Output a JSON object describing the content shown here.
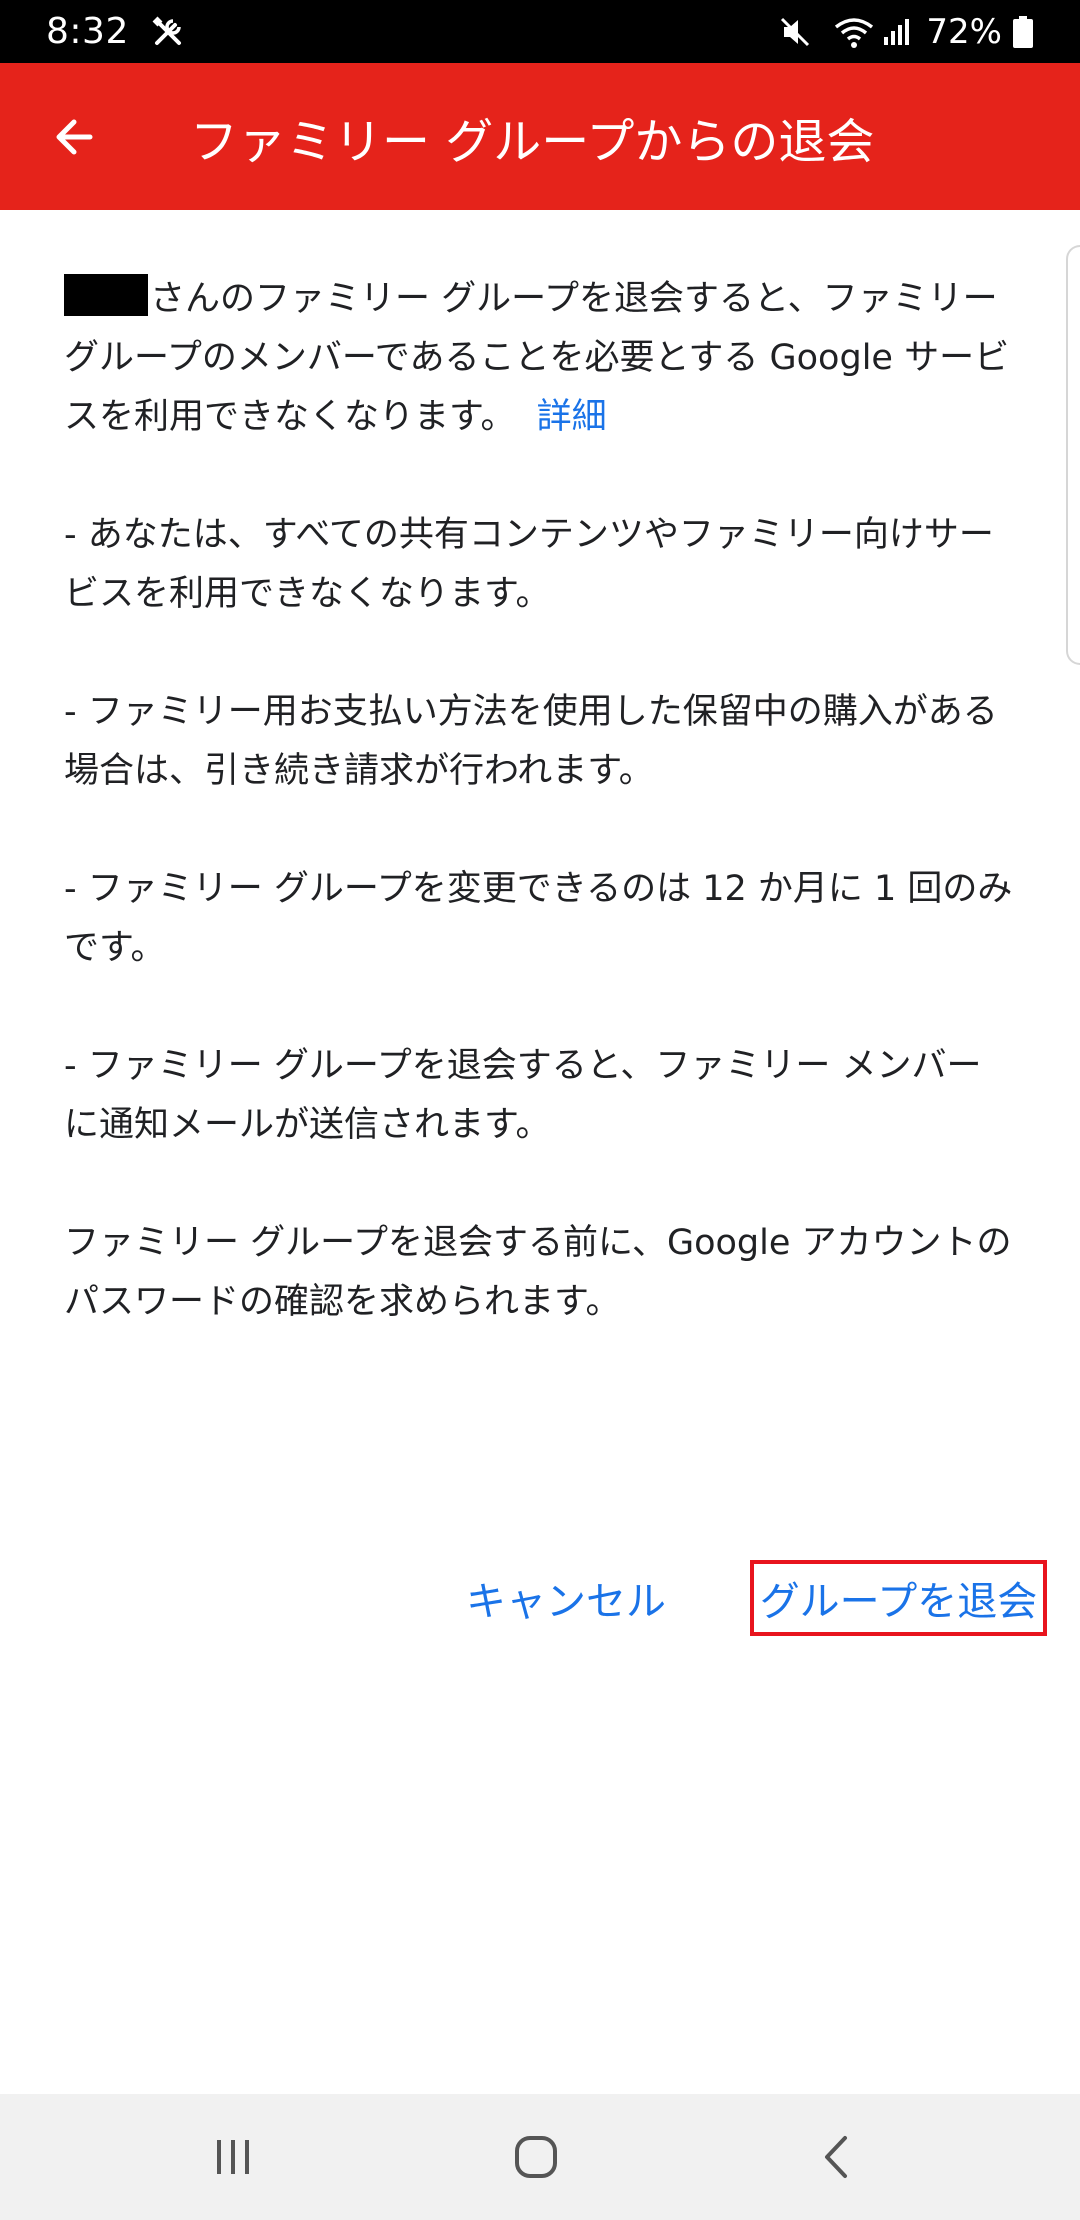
{
  "status_bar": {
    "time": "8:32",
    "battery": "72%",
    "icons": [
      "tools-icon",
      "mute-icon",
      "wifi-icon",
      "signal-icon",
      "battery-icon"
    ]
  },
  "app_bar": {
    "title": "ファミリー グループからの退会",
    "back_icon": "arrow-left-icon",
    "color": "#e5231b"
  },
  "content": {
    "intro_text": "さんのファミリー グループを退会すると、ファミリー グループのメンバーであることを必要とする Google サービスを利用できなくなります。",
    "detail_link": "詳細",
    "bullet_1": "- あなたは、すべての共有コンテンツやファミリー向けサービスを利用できなくなります。",
    "bullet_2": "- ファミリー用お支払い方法を使用した保留中の購入がある場合は、引き続き請求が行われます。",
    "bullet_3": "- ファミリー グループを変更できるのは 12 か月に 1 回のみです。",
    "bullet_4": "- ファミリー グループを退会すると、ファミリー メンバーに通知メールが送信されます。",
    "footer_note": "ファミリー グループを退会する前に、Google アカウントのパスワードの確認を求められます。"
  },
  "actions": {
    "cancel_label": "キャンセル",
    "leave_label": "グループを退会",
    "link_color": "#1a73e8",
    "highlight_color": "#e8141d"
  },
  "nav_bar": {
    "icons": [
      "recent-apps-icon",
      "home-icon",
      "back-icon"
    ]
  }
}
